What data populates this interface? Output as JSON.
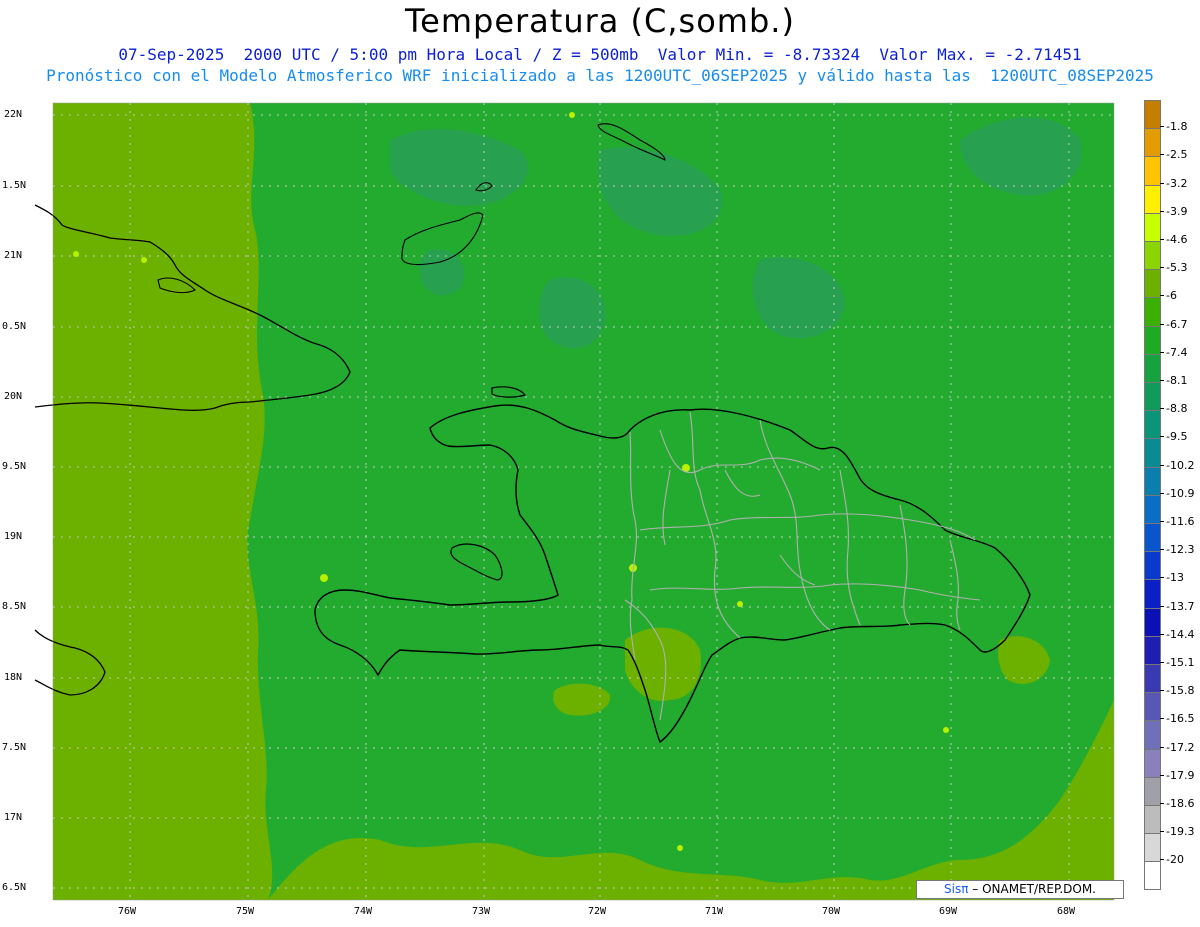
{
  "header": {
    "title": "Temperatura (C,somb.)",
    "subtitle_1": "07-Sep-2025  2000 UTC / 5:00 pm Hora Local / Z = 500mb  Valor Min. = -8.73324  Valor Max. = -2.71451",
    "subtitle_2": "Pronóstico con el Modelo Atmosferico WRF inicializado a las 1200UTC_06SEP2025 y válido hasta las  1200UTC_08SEP2025"
  },
  "map": {
    "lon_labels": [
      "76W",
      "75W",
      "74W",
      "73W",
      "72W",
      "71W",
      "70W",
      "69W",
      "68W"
    ],
    "lat_labels": [
      "22N",
      "1.5N",
      "21N",
      "0.5N",
      "20N",
      "9.5N",
      "19N",
      "8.5N",
      "18N",
      "7.5N",
      "17N",
      "6.5N"
    ],
    "lon_range": [
      -76.65,
      -67.65
    ],
    "lat_range": [
      16.4,
      22.1
    ],
    "colors": {
      "ocean_field": "#23ab2f",
      "warm_field": "#6cb000",
      "cool_patch": "#27a050",
      "hot_spot": "#b8f000",
      "coastline": "#000000",
      "province_border": "#b0b0b0",
      "grid": "#c8c8c8"
    }
  },
  "legend": {
    "labels": [
      "-1.8",
      "-2.5",
      "-3.2",
      "-3.9",
      "-4.6",
      "-5.3",
      "-6",
      "-6.7",
      "-7.4",
      "-8.1",
      "-8.8",
      "-9.5",
      "-10.2",
      "-10.9",
      "-11.6",
      "-12.3",
      "-13",
      "-13.7",
      "-14.4",
      "-15.1",
      "-15.8",
      "-16.5",
      "-17.2",
      "-17.9",
      "-18.6",
      "-19.3",
      "-20"
    ],
    "colors": [
      "#c47f00",
      "#e29b00",
      "#ffc400",
      "#fff000",
      "#c8ff00",
      "#8bd400",
      "#6cb000",
      "#3cb000",
      "#1dab24",
      "#16a33f",
      "#129a5c",
      "#0a9478",
      "#0a8a92",
      "#0a7fad",
      "#0a6ec4",
      "#0a55cc",
      "#0a3acc",
      "#0a20c6",
      "#0a10b4",
      "#1e1eb0",
      "#3a3ab0",
      "#5858b4",
      "#7070b8",
      "#8c80bc",
      "#a0a0a8",
      "#bcbcbc",
      "#d8d8d8",
      "#ffffff"
    ]
  },
  "credit": {
    "logo": "Sisπ",
    "org": "ONAMET/REP.DOM."
  }
}
